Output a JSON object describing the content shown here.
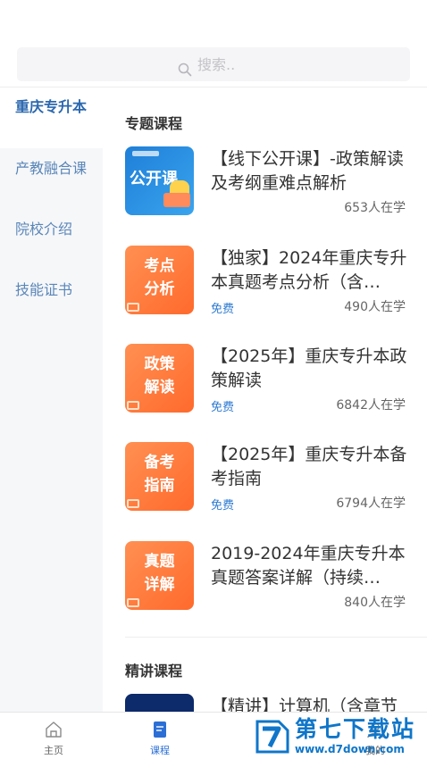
{
  "search": {
    "placeholder": "搜索.."
  },
  "sidebar": {
    "items": [
      {
        "label": "重庆专升本",
        "active": true
      },
      {
        "label": "产教融合课",
        "active": false
      },
      {
        "label": "院校介绍",
        "active": false
      },
      {
        "label": "技能证书",
        "active": false
      }
    ]
  },
  "sections": [
    {
      "title": "专题课程",
      "courses": [
        {
          "thumb": "公开课",
          "title": "【线下公开课】-政策解读及考纲重难点解析",
          "tag": "",
          "learners": "653人在学"
        },
        {
          "thumb_line1": "考点",
          "thumb_line2": "分析",
          "title": "【独家】2024年重庆专升本真题考点分析（含…",
          "tag": "免费",
          "learners": "490人在学"
        },
        {
          "thumb_line1": "政策",
          "thumb_line2": "解读",
          "title": "【2025年】重庆专升本政策解读",
          "tag": "免费",
          "learners": "6842人在学"
        },
        {
          "thumb_line1": "备考",
          "thumb_line2": "指南",
          "title": "【2025年】重庆专升本备考指南",
          "tag": "免费",
          "learners": "6794人在学"
        },
        {
          "thumb_line1": "真题",
          "thumb_line2": "详解",
          "title": "2019-2024年重庆专升本真题答案详解（持续…",
          "tag": "",
          "learners": "840人在学"
        }
      ]
    },
    {
      "title": "精讲课程",
      "courses": [
        {
          "title": "【精讲】计算机（含章节"
        }
      ]
    }
  ],
  "bottom_nav": [
    {
      "label": "主页",
      "icon": "home-icon",
      "active": false
    },
    {
      "label": "课程",
      "icon": "book-icon",
      "active": true
    },
    {
      "label": "我的",
      "icon": "user-icon",
      "active": false
    }
  ],
  "watermark": {
    "title": "第七下载站",
    "url": "www.d7down.com"
  },
  "colors": {
    "accent": "#2b6fd6",
    "orange": "#ff7a3a",
    "link": "#2e7bd1"
  }
}
